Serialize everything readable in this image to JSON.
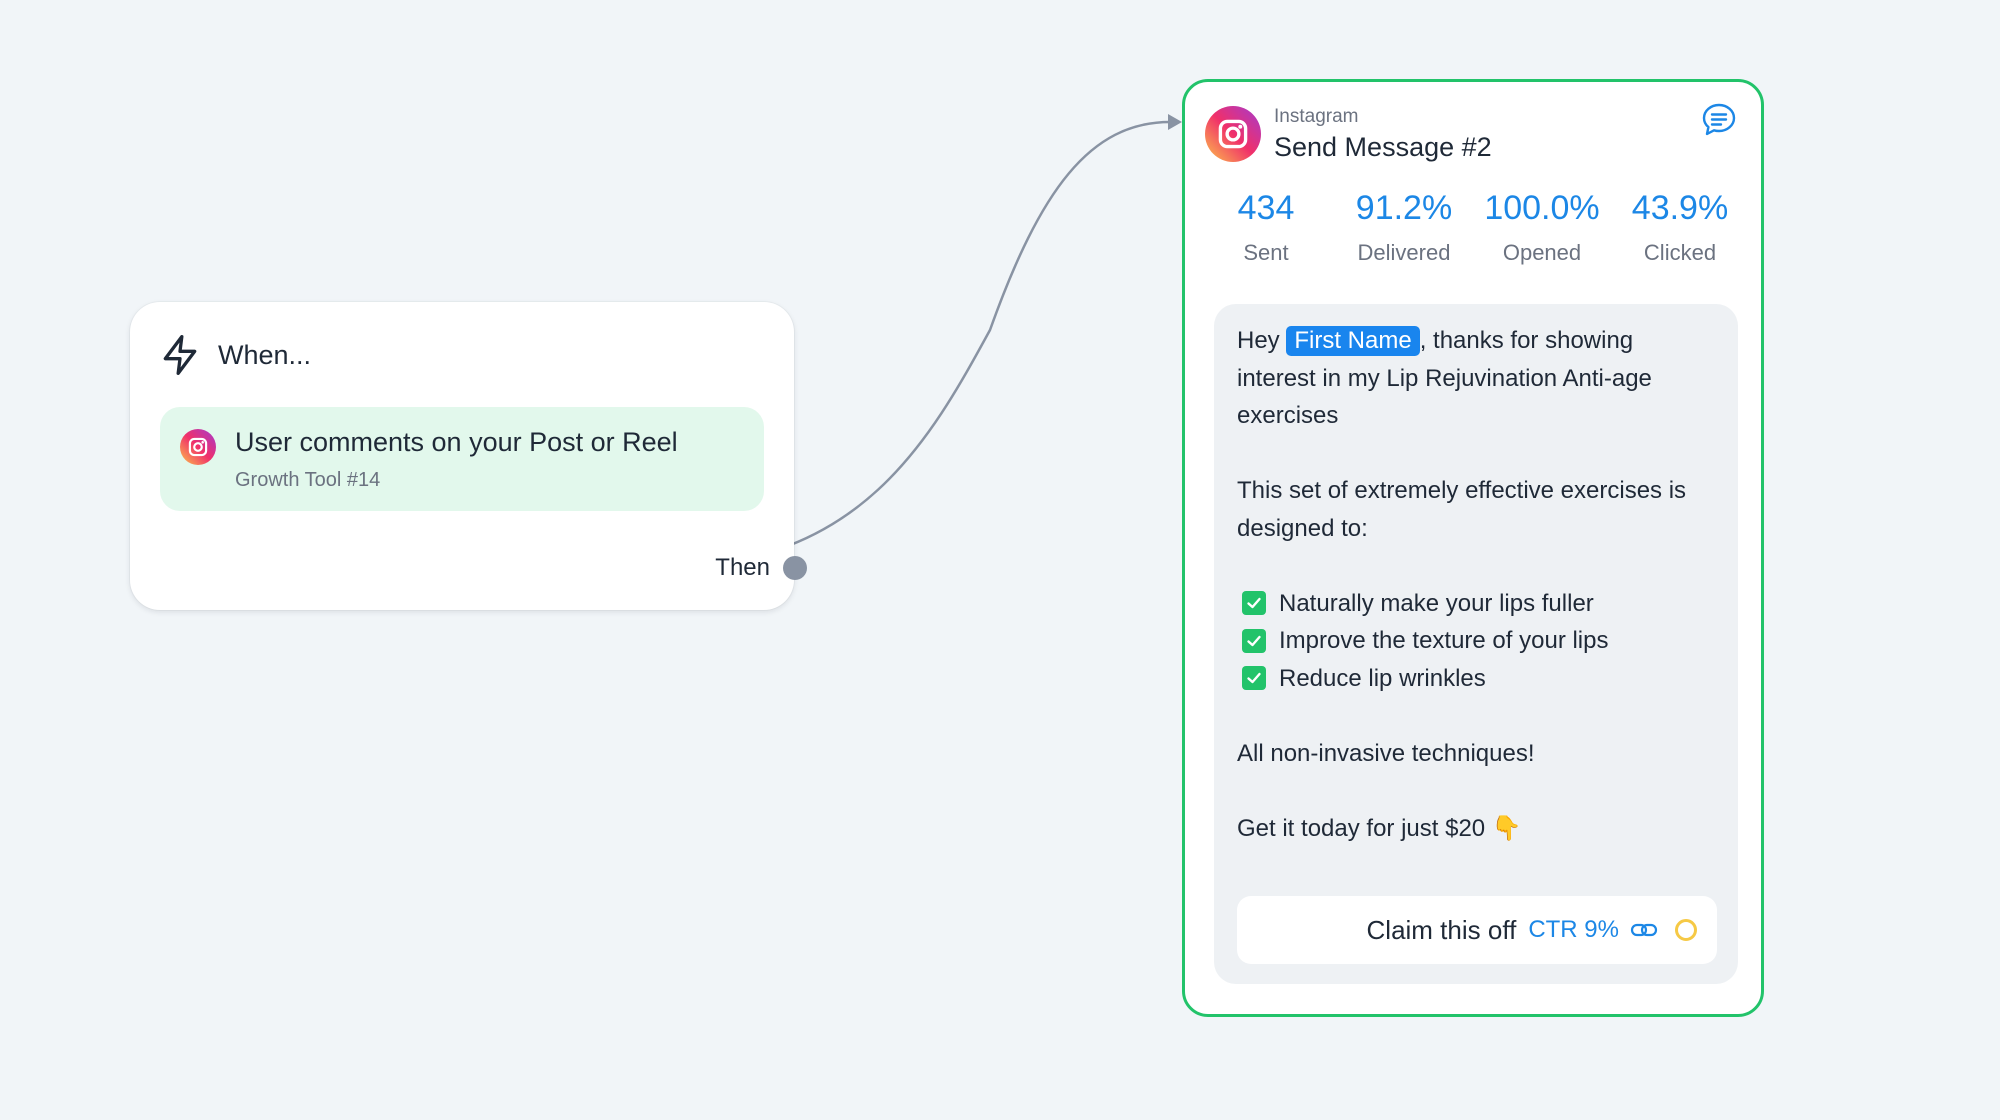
{
  "trigger": {
    "title": "When...",
    "event_title": "User comments on your Post or Reel",
    "event_subtitle": "Growth Tool #14",
    "then_label": "Then",
    "bolt_icon": "lightning-icon",
    "platform_icon": "instagram-icon"
  },
  "message": {
    "platform": "Instagram",
    "title": "Send Message #2",
    "chat_icon": "chat-bubble-icon",
    "stats": [
      {
        "value": "434",
        "label": "Sent"
      },
      {
        "value": "91.2%",
        "label": "Delivered"
      },
      {
        "value": "100.0%",
        "label": "Opened"
      },
      {
        "value": "43.9%",
        "label": "Clicked"
      }
    ],
    "body": {
      "greeting_prefix": "Hey",
      "first_name_chip": "First Name",
      "greeting_rest": ", thanks for showing interest in my Lip Rejuvination Anti-age exercises",
      "intro": "This set of extremely effective exercises is designed to:",
      "checklist": [
        "Naturally make your lips fuller",
        "Improve the texture of your lips",
        "Reduce lip wrinkles"
      ],
      "line_noninvasive": "All non-invasive techniques!",
      "line_price": "Get it today for just $20",
      "price_emoji": "👇"
    },
    "button": {
      "label": "Claim this off",
      "ctr": "CTR 9%",
      "link_icon": "link-icon",
      "status_icon": "pending-status-icon"
    }
  },
  "colors": {
    "accent_blue": "#1c87e6",
    "success_green": "#22c36a",
    "trigger_item_bg": "#e2f8ec",
    "canvas_bg": "#f1f5f8",
    "connector_gray": "#8993a3"
  }
}
